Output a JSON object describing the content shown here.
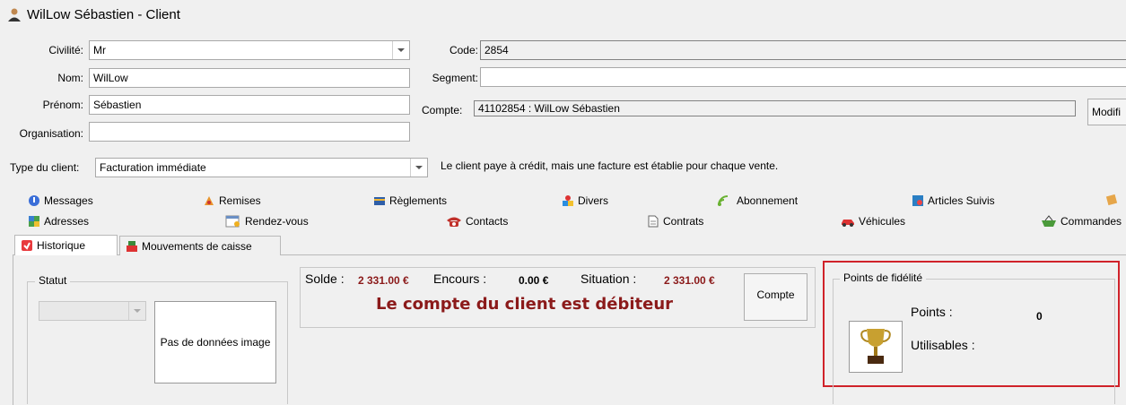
{
  "window": {
    "title": "WilLow Sébastien - Client"
  },
  "form": {
    "civilite_label": "Civilité:",
    "civilite_value": "Mr",
    "nom_label": "Nom:",
    "nom_value": "WilLow",
    "prenom_label": "Prénom:",
    "prenom_value": "Sébastien",
    "organisation_label": "Organisation:",
    "organisation_value": "",
    "code_label": "Code:",
    "code_value": "2854",
    "segment_label": "Segment:",
    "segment_value": "",
    "compte_label": "Compte:",
    "compte_value": "41102854 : WilLow Sébastien",
    "modifier_label": "Modifi",
    "type_label": "Type du client:",
    "type_value": "Facturation immédiate",
    "type_description": "Le client paye à crédit, mais une facture est établie pour chaque vente."
  },
  "nav": {
    "row1": [
      "Messages",
      "Remises",
      "Règlements",
      "Divers",
      "Abonnement",
      "Articles Suivis"
    ],
    "row2": [
      "Adresses",
      "Rendez-vous",
      "Contacts",
      "Contrats",
      "Véhicules",
      "Commandes"
    ]
  },
  "tabs": [
    "Historique",
    "Mouvements de caisse"
  ],
  "statut": {
    "title": "Statut",
    "select_value": "",
    "image_text": "Pas de données image"
  },
  "solde": {
    "solde_label": "Solde :",
    "solde_value": "2 331.00 €",
    "encours_label": "Encours :",
    "encours_value": "0.00 €",
    "situation_label": "Situation :",
    "situation_value": "2 331.00 €",
    "message": "Le compte du client est débiteur",
    "compte_button": "Compte"
  },
  "fidelite": {
    "title": "Points de fidélité",
    "points_label": "Points :",
    "points_value": "0",
    "utilisables_label": "Utilisables :",
    "utilisables_value": ""
  },
  "colors": {
    "accent_red": "#8b1a1a",
    "highlight": "#d0222a"
  },
  "icons": [
    "person-icon",
    "message-icon",
    "discount-icon",
    "payment-card-icon",
    "misc-shapes-icon",
    "rss-icon",
    "tracked-items-icon",
    "note-icon",
    "map-icon",
    "calendar-icon",
    "phone-icon",
    "document-icon",
    "car-icon",
    "basket-icon",
    "history-icon",
    "cash-register-icon",
    "trophy-icon"
  ]
}
